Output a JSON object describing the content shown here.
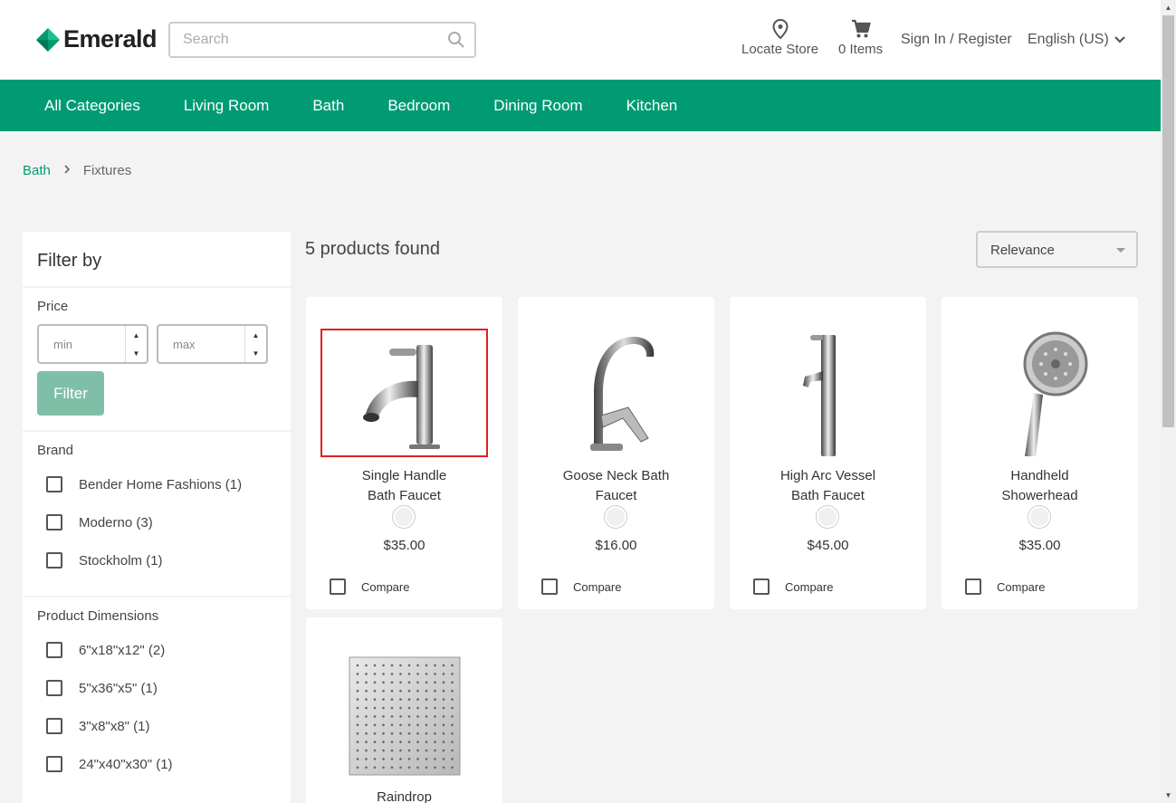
{
  "header": {
    "brand": "Emerald",
    "search_placeholder": "Search",
    "locate_store": "Locate Store",
    "cart": "0 Items",
    "sign_in": "Sign In / Register",
    "language": "English (US)"
  },
  "nav": {
    "items": [
      "All Categories",
      "Living Room",
      "Bath",
      "Bedroom",
      "Dining Room",
      "Kitchen"
    ]
  },
  "breadcrumb": {
    "parent": "Bath",
    "current": "Fixtures"
  },
  "sidebar": {
    "title": "Filter by",
    "price_label": "Price",
    "min_placeholder": "min",
    "max_placeholder": "max",
    "filter_button": "Filter",
    "brand_label": "Brand",
    "brands": [
      "Bender Home Fashions (1)",
      "Moderno (3)",
      "Stockholm (1)"
    ],
    "dimensions_label": "Product Dimensions",
    "dimensions": [
      "6\"x18\"x12\" (2)",
      "5\"x36\"x5\" (1)",
      "3\"x8\"x8\" (1)",
      "24\"x40\"x30\" (1)"
    ]
  },
  "results": {
    "count_text": "5 products found",
    "sort_value": "Relevance"
  },
  "products": [
    {
      "name_line1": "Single Handle",
      "name_line2": "Bath Faucet",
      "price": "$35.00",
      "compare": "Compare",
      "image": "faucet-icon",
      "selected": true
    },
    {
      "name_line1": "Goose Neck Bath",
      "name_line2": "Faucet",
      "price": "$16.00",
      "compare": "Compare",
      "image": "gooseneck-faucet-icon",
      "selected": false
    },
    {
      "name_line1": "High Arc Vessel",
      "name_line2": "Bath Faucet",
      "price": "$45.00",
      "compare": "Compare",
      "image": "tall-faucet-icon",
      "selected": false
    },
    {
      "name_line1": "Handheld",
      "name_line2": "Showerhead",
      "price": "$35.00",
      "compare": "Compare",
      "image": "showerhead-icon",
      "selected": false
    },
    {
      "name_line1": "Raindrop",
      "name_line2": "",
      "price": "",
      "compare": "",
      "image": "rain-showerhead-icon",
      "selected": false
    }
  ],
  "colors": {
    "brand_green": "#009b72",
    "filter_button": "#7fbfa8",
    "selection_outline": "#e02020"
  }
}
